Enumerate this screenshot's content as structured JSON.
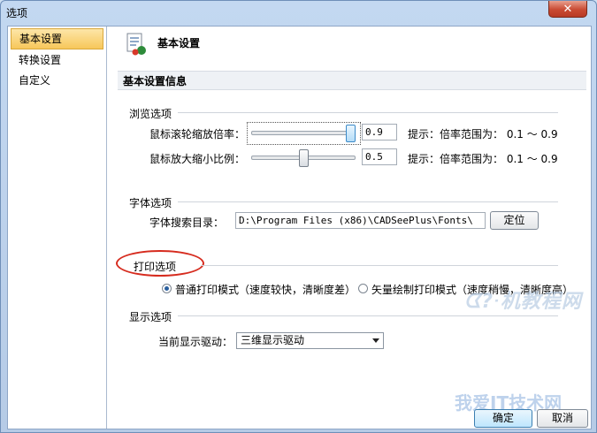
{
  "window": {
    "title": "选项",
    "close_glyph": "✕"
  },
  "sidebar": {
    "items": [
      {
        "label": "基本设置",
        "active": true
      },
      {
        "label": "转换设置",
        "active": false
      },
      {
        "label": "自定义",
        "active": false
      }
    ]
  },
  "header": {
    "title": "基本设置",
    "icon": "settings-sheet-icon"
  },
  "section_title": "基本设置信息",
  "browse": {
    "group_label": "浏览选项",
    "wheel": {
      "label": "鼠标滚轮缩放倍率：",
      "value": "0.9",
      "hint": "提示：倍率范围为： 0.1 ～ 0.9",
      "level": 0.9
    },
    "zoom": {
      "label": "鼠标放大缩小比例：",
      "value": "0.5",
      "hint": "提示：倍率范围为： 0.1 ～ 0.9",
      "level": 0.5
    }
  },
  "font": {
    "group_label": "字体选项",
    "dir_label": "字体搜索目录：",
    "dir_value": "D:\\Program Files (x86)\\CADSeePlus\\Fonts\\",
    "locate_button": "定位"
  },
  "print": {
    "group_label": "打印选项",
    "option_normal": "普通打印模式（速度较快，清晰度差）",
    "option_vector": "矢量绘制打印模式（速度稍慢，清晰度高）",
    "selected": "normal"
  },
  "display": {
    "group_label": "显示选项",
    "driver_label": "当前显示驱动：",
    "driver_value": "三维显示驱动"
  },
  "footer": {
    "ok_button": "确定",
    "cancel_button": "取消"
  },
  "watermark": {
    "text1": "ᗧ?ᐧ机教程网",
    "text2": "我爱IT技术网"
  },
  "colors": {
    "highlight_oval": "#d62b1e",
    "active_item": "#f7c75a"
  }
}
